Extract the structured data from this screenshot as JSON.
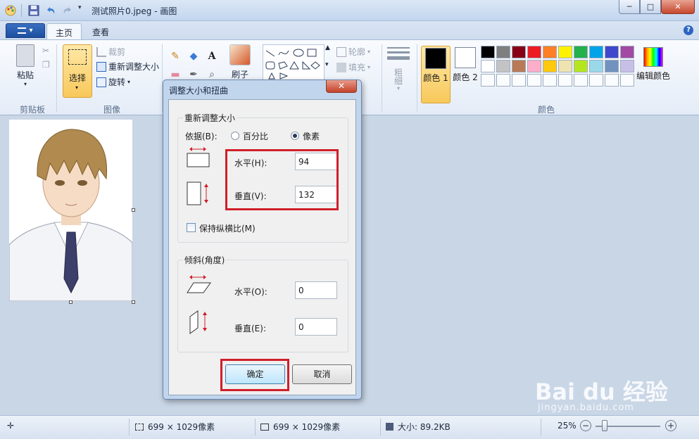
{
  "window": {
    "title": "测试照片0.jpeg - 画图",
    "buttons": {
      "minimize": "─",
      "maximize": "□",
      "close": "✕"
    }
  },
  "tabs": {
    "home": "主页",
    "view": "查看",
    "file_menu": "▾"
  },
  "ribbon": {
    "clipboard": {
      "paste": "粘贴",
      "group": "剪贴板"
    },
    "image": {
      "select": "选择",
      "crop": "裁剪",
      "resize": "重新调整大小",
      "rotate": "旋转",
      "group": "图像"
    },
    "tools": {
      "brush": "刷子"
    },
    "shapes": {
      "outline": "轮廓",
      "fill": "填充"
    },
    "size": {
      "label": "粗细"
    },
    "colors": {
      "color1": "颜色 1",
      "color2": "颜色 2",
      "edit": "编辑颜色",
      "group": "颜色",
      "color1_value": "#000000",
      "color2_value": "#ffffff",
      "palette_row1": [
        "#000000",
        "#7f7f7f",
        "#880015",
        "#ed1c24",
        "#ff7f27",
        "#fff200",
        "#22b14c",
        "#00a2e8",
        "#3f48cc",
        "#a349a4"
      ],
      "palette_row2": [
        "#ffffff",
        "#c3c3c3",
        "#b97a57",
        "#ffaec9",
        "#ffc90e",
        "#efe4b0",
        "#b5e61d",
        "#99d9ea",
        "#7092be",
        "#c8bfe7"
      ]
    }
  },
  "dialog": {
    "title": "调整大小和扭曲",
    "resize": {
      "legend": "重新调整大小",
      "by_label": "依据(B):",
      "option_percent": "百分比",
      "option_pixels": "像素",
      "horizontal_label": "水平(H):",
      "horizontal_value": "94",
      "vertical_label": "垂直(V):",
      "vertical_value": "132",
      "keep_ratio": "保持纵横比(M)"
    },
    "skew": {
      "legend": "倾斜(角度)",
      "horizontal_label": "水平(O):",
      "horizontal_value": "0",
      "vertical_label": "垂直(E):",
      "vertical_value": "0"
    },
    "ok": "确定",
    "cancel": "取消"
  },
  "status": {
    "selection_size": "699 × 1029像素",
    "image_size": "699 × 1029像素",
    "file_size": "大小: 89.2KB",
    "zoom": "25%"
  },
  "watermark": {
    "brand": "Bai du 经验",
    "url": "jingyan.baidu.com"
  }
}
